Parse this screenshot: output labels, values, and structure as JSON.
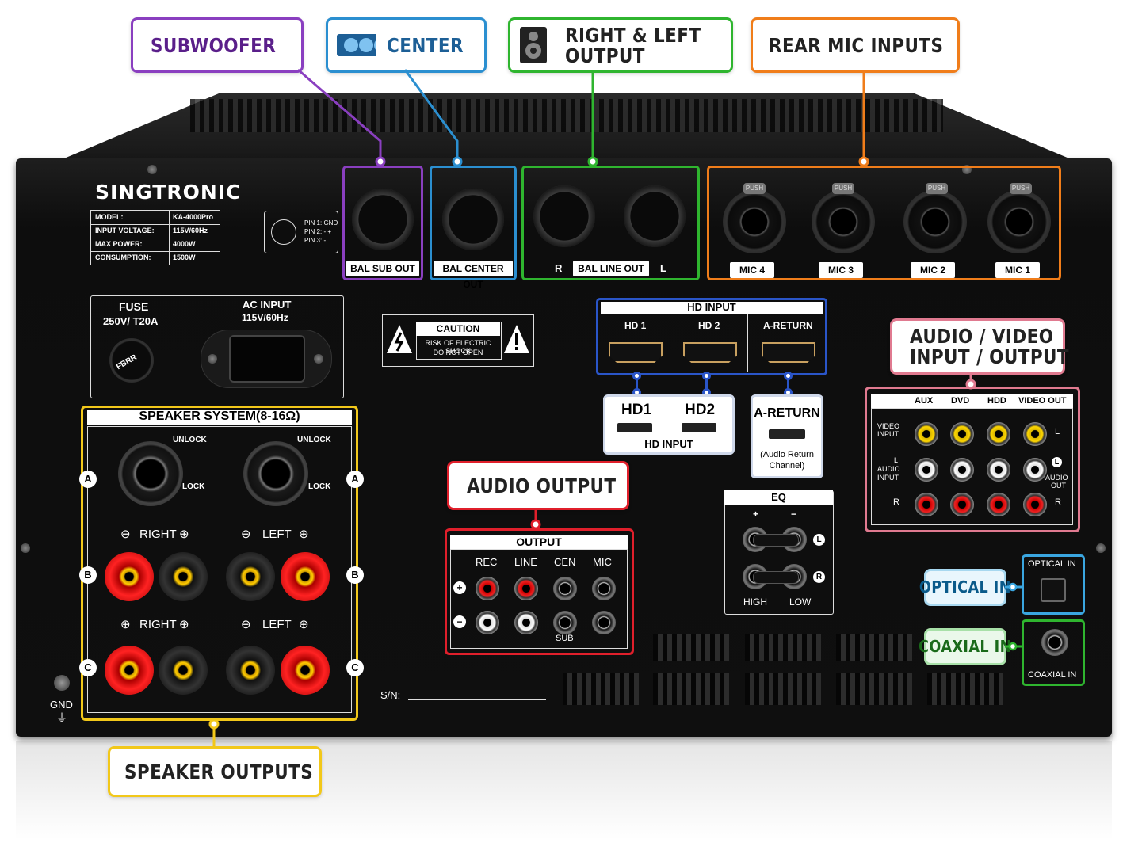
{
  "callouts": {
    "subwoofer": "SUBWOOFER",
    "center": "CENTER",
    "right_left_line1": "RIGHT & LEFT",
    "right_left_line2": "OUTPUT",
    "rear_mic": "REAR MIC INPUTS",
    "audio_video_line1": "AUDIO / VIDEO",
    "audio_video_line2": "INPUT / OUTPUT",
    "audio_output": "AUDIO OUTPUT",
    "optical_in": "OPTICAL IN",
    "coaxial_in": "COAXIAL IN",
    "speaker_outputs": "SPEAKER OUTPUTS"
  },
  "colors": {
    "subwoofer": "#8a3fc0",
    "center": "#2b8fd0",
    "right_left": "#2fb52f",
    "rear_mic": "#f07d1a",
    "audio_video": "#e07a90",
    "audio_output": "#e01f2b",
    "optical": "#3aa6e0",
    "coaxial": "#2fb52f",
    "speaker": "#f2c81a",
    "hd_input": "#2a55c8"
  },
  "brand": "SINGTRONIC",
  "spec_table": [
    {
      "label": "MODEL:",
      "value": "KA-4000Pro"
    },
    {
      "label": "INPUT VOLTAGE:",
      "value": "115V/60Hz"
    },
    {
      "label": "MAX POWER:",
      "value": "4000W"
    },
    {
      "label": "CONSUMPTION:",
      "value": "1500W"
    }
  ],
  "pin_legend": [
    "PIN 1: GND",
    "PIN 2: - +",
    "PIN 3: -"
  ],
  "rear": {
    "bal_sub_out": "BAL SUB OUT",
    "bal_center_out": "BAL CENTER OUT",
    "bal_line_out": "BAL LINE OUT",
    "line_r": "R",
    "line_l": "L",
    "mics": [
      "MIC 4",
      "MIC 3",
      "MIC 2",
      "MIC 1"
    ],
    "push": "PUSH",
    "fuse_title": "FUSE",
    "fuse_rating": "250V/ T20A",
    "fuse_cap": "FBRR",
    "ac_title": "AC INPUT",
    "ac_rating": "115V/60Hz",
    "caution_title": "CAUTION",
    "caution_line1": "RISK OF ELECTRIC SHOCK",
    "caution_line2": "DO NOT OPEN",
    "sn_label": "S/N:",
    "gnd": "GND"
  },
  "hd": {
    "title": "HD INPUT",
    "ports": [
      "HD 1",
      "HD 2",
      "A-RETURN"
    ],
    "card_hd1": "HD1",
    "card_hd2": "HD2",
    "card_hd_caption": "HD INPUT",
    "card_areturn": "A-RETURN",
    "card_areturn_note1": "(Audio Return",
    "card_areturn_note2": "Channel)"
  },
  "speaker_system": {
    "title": "SPEAKER SYSTEM(8-16Ω)",
    "unlock": "UNLOCK",
    "lock": "LOCK",
    "right": "RIGHT",
    "left": "LEFT",
    "rows": [
      "A",
      "B",
      "C"
    ]
  },
  "output_panel": {
    "title": "OUTPUT",
    "cols": [
      "REC",
      "LINE",
      "CEN",
      "MIC"
    ],
    "sub": "SUB",
    "plus": "+",
    "minus": "−"
  },
  "eq": {
    "title": "EQ",
    "plus": "+",
    "minus": "−",
    "high": "HIGH",
    "low": "LOW",
    "l": "L",
    "r": "R"
  },
  "av_panel": {
    "cols": [
      "AUX",
      "DVD",
      "HDD",
      "VIDEO OUT"
    ],
    "video_input": [
      "VIDEO",
      "INPUT"
    ],
    "audio_input": [
      "L",
      "AUDIO",
      "INPUT"
    ],
    "r": "R",
    "l": "L",
    "audio_out": [
      "AUDIO",
      "OUT"
    ]
  },
  "optical_label": "OPTICAL IN",
  "coaxial_label": "COAXIAL IN"
}
